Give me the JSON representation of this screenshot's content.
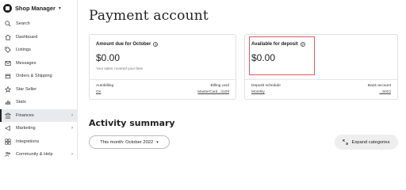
{
  "sidebar": {
    "brand": "Shop Manager",
    "items": [
      {
        "label": "Search",
        "icon": "search-icon",
        "name": "sidebar-item-search"
      },
      {
        "label": "Dashboard",
        "icon": "home-icon",
        "name": "sidebar-item-dashboard"
      },
      {
        "label": "Listings",
        "icon": "tag-icon",
        "name": "sidebar-item-listings"
      },
      {
        "label": "Messages",
        "icon": "mail-icon",
        "name": "sidebar-item-messages"
      },
      {
        "label": "Orders & Shipping",
        "icon": "box-icon",
        "name": "sidebar-item-orders"
      },
      {
        "label": "Star Seller",
        "icon": "star-icon",
        "name": "sidebar-item-star-seller"
      },
      {
        "label": "Stats",
        "icon": "bar-chart-icon",
        "name": "sidebar-item-stats"
      },
      {
        "label": "Finances",
        "icon": "bank-icon",
        "name": "sidebar-item-finances",
        "active": true,
        "has_chevron": true
      },
      {
        "label": "Marketing",
        "icon": "megaphone-icon",
        "name": "sidebar-item-marketing",
        "has_chevron": true
      },
      {
        "label": "Integrations",
        "icon": "grid-icon",
        "name": "sidebar-item-integrations"
      },
      {
        "label": "Community & Help",
        "icon": "people-icon",
        "name": "sidebar-item-community",
        "has_chevron": true
      }
    ]
  },
  "main": {
    "title": "Payment account",
    "cards": {
      "due": {
        "heading": "Amount due for October",
        "amount": "$0.00",
        "note": "Your sales covered your fees",
        "left_label": "Autobilling",
        "left_value": "On",
        "right_label": "Billing card",
        "right_value": "MasterCard...3109"
      },
      "deposit": {
        "heading": "Available for deposit",
        "amount": "$0.00",
        "left_label": "Deposit schedule",
        "left_value": "Monthly",
        "right_label": "Bank account",
        "right_value": "...5022"
      }
    },
    "activity": {
      "title": "Activity summary",
      "period": "This month: October 2022",
      "expand": "Expand categories"
    }
  },
  "colors": {
    "highlight": "#e05a62",
    "active_nav_bg": "#e8eaed"
  }
}
